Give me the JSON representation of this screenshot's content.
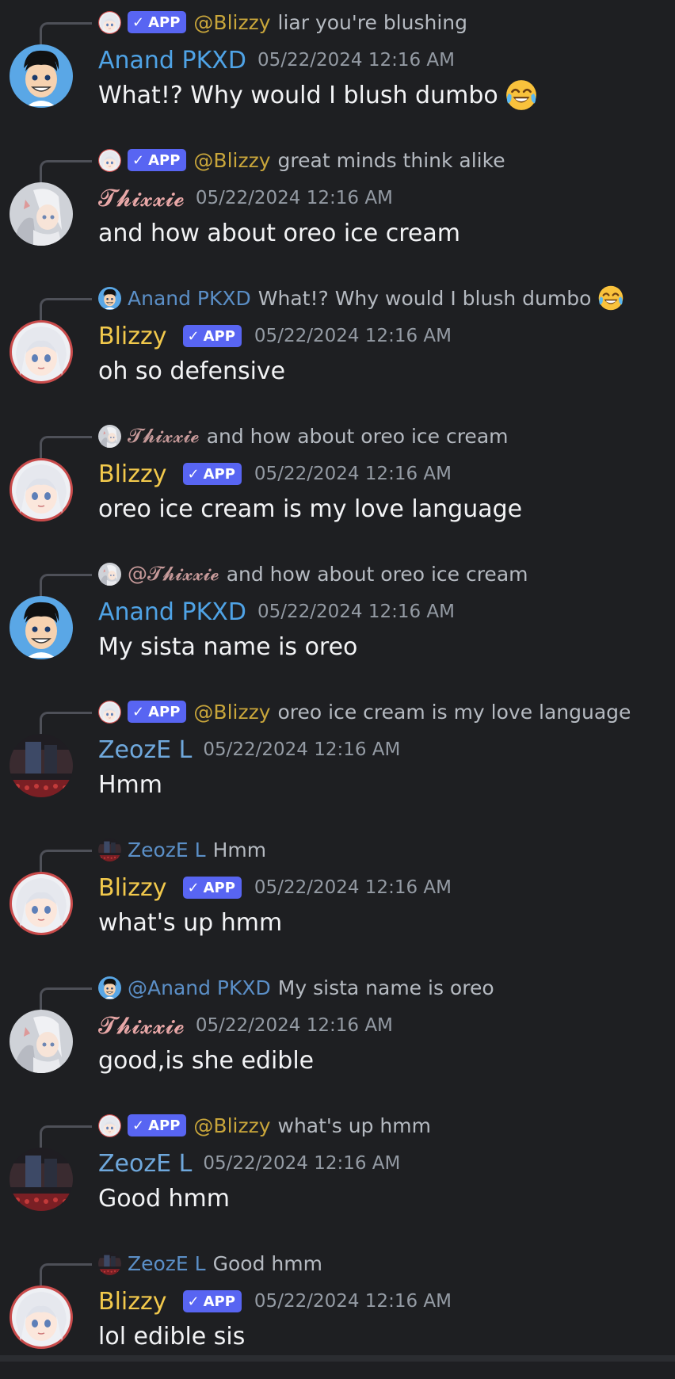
{
  "badge_label": "APP",
  "colors": {
    "background": "#1e1f22",
    "anand": "#4fa3e6",
    "thixxie": "#e8a7a7",
    "blizzy": "#f2c94c",
    "zeoze": "#6fa8dc",
    "mention_blizzy": "#c9a63b",
    "mention_thixxie": "#c79a9a",
    "mention_anand": "#5b8fc7",
    "mention_zeoze": "#5b8fc7",
    "app_badge": "#5865f2",
    "timestamp": "#949ba4"
  },
  "messages": [
    {
      "reply": {
        "avatar": "blizzy",
        "prefix": "@",
        "name": "Blizzy",
        "app": true,
        "text": "liar you're blushing",
        "emoji": false
      },
      "author": {
        "avatar": "anand",
        "name": "Anand PKXD",
        "app": false
      },
      "timestamp": "05/22/2024 12:16 AM",
      "text": "What!? Why would I blush dumbo",
      "emoji": true
    },
    {
      "reply": {
        "avatar": "blizzy",
        "prefix": "@",
        "name": "Blizzy",
        "app": true,
        "text": "great minds think alike",
        "emoji": false
      },
      "author": {
        "avatar": "thixxie",
        "name": "𝓣𝓱𝓲𝔁𝔁𝓲𝓮",
        "app": false
      },
      "timestamp": "05/22/2024 12:16 AM",
      "text": "and how about oreo ice cream",
      "emoji": false
    },
    {
      "reply": {
        "avatar": "anand",
        "prefix": "",
        "name": "Anand PKXD",
        "app": false,
        "text": "What!? Why would I blush dumbo",
        "emoji": true
      },
      "author": {
        "avatar": "blizzy",
        "name": "Blizzy",
        "app": true
      },
      "timestamp": "05/22/2024 12:16 AM",
      "text": "oh so defensive",
      "emoji": false
    },
    {
      "reply": {
        "avatar": "thixxie",
        "prefix": "",
        "name": "𝓣𝓱𝓲𝔁𝔁𝓲𝓮",
        "app": false,
        "text": "and how about oreo ice cream",
        "emoji": false
      },
      "author": {
        "avatar": "blizzy",
        "name": "Blizzy",
        "app": true
      },
      "timestamp": "05/22/2024 12:16 AM",
      "text": "oreo ice cream is my love language",
      "emoji": false
    },
    {
      "reply": {
        "avatar": "thixxie",
        "prefix": "@",
        "name": "𝓣𝓱𝓲𝔁𝔁𝓲𝓮",
        "app": false,
        "text": "and how about oreo ice cream",
        "emoji": false
      },
      "author": {
        "avatar": "anand",
        "name": "Anand PKXD",
        "app": false
      },
      "timestamp": "05/22/2024 12:16 AM",
      "text": "My sista name is oreo",
      "emoji": false
    },
    {
      "reply": {
        "avatar": "blizzy",
        "prefix": "@",
        "name": "Blizzy",
        "app": true,
        "text": "oreo ice cream is my love language",
        "emoji": false
      },
      "author": {
        "avatar": "zeoze",
        "name": "ZeozE L",
        "app": false
      },
      "timestamp": "05/22/2024 12:16 AM",
      "text": "Hmm",
      "emoji": false
    },
    {
      "reply": {
        "avatar": "zeoze",
        "prefix": "",
        "name": "ZeozE L",
        "app": false,
        "text": "Hmm",
        "emoji": false
      },
      "author": {
        "avatar": "blizzy",
        "name": "Blizzy",
        "app": true
      },
      "timestamp": "05/22/2024 12:16 AM",
      "text": "what's up hmm",
      "emoji": false
    },
    {
      "reply": {
        "avatar": "anand",
        "prefix": "@",
        "name": "Anand PKXD",
        "app": false,
        "text": "My sista name is oreo",
        "emoji": false
      },
      "author": {
        "avatar": "thixxie",
        "name": "𝓣𝓱𝓲𝔁𝔁𝓲𝓮",
        "app": false
      },
      "timestamp": "05/22/2024 12:16 AM",
      "text": "good,is she edible",
      "emoji": false
    },
    {
      "reply": {
        "avatar": "blizzy",
        "prefix": "@",
        "name": "Blizzy",
        "app": true,
        "text": "what's up hmm",
        "emoji": false
      },
      "author": {
        "avatar": "zeoze",
        "name": "ZeozE L",
        "app": false
      },
      "timestamp": "05/22/2024 12:16 AM",
      "text": "Good hmm",
      "emoji": false
    },
    {
      "reply": {
        "avatar": "zeoze",
        "prefix": "",
        "name": "ZeozE L",
        "app": false,
        "text": "Good hmm",
        "emoji": false
      },
      "author": {
        "avatar": "blizzy",
        "name": "Blizzy",
        "app": true
      },
      "timestamp": "05/22/2024 12:16 AM",
      "text": "lol edible sis",
      "emoji": false
    }
  ]
}
